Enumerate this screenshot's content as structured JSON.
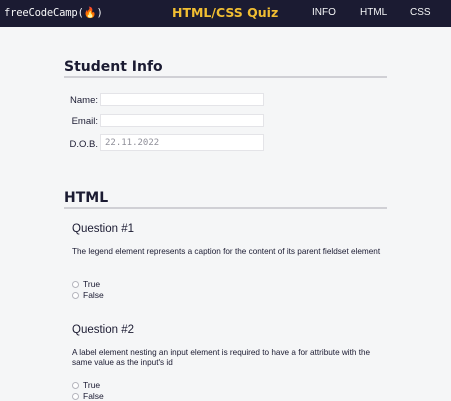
{
  "header": {
    "logo": "freeCodeCamp(🔥)",
    "title": "HTML/CSS Quiz",
    "nav": [
      "INFO",
      "HTML",
      "CSS"
    ]
  },
  "student_info": {
    "title": "Student Info",
    "name_label": "Name:",
    "email_label": "Email:",
    "dob_label": "D.O.B.",
    "dob_value": "22.11.2022"
  },
  "html_section": {
    "title": "HTML",
    "questions": [
      {
        "title": "Question #1",
        "text": "The legend element represents a caption for the content of its parent fieldset element",
        "options": [
          "True",
          "False"
        ]
      },
      {
        "title": "Question #2",
        "text": "A label element nesting an input element is required to have a for attribute with the same value as the input's id",
        "options": [
          "True",
          "False"
        ]
      }
    ]
  },
  "colors": {
    "header_bg": "#1b1b32",
    "title_accent": "#f1be32",
    "page_bg": "#f5f6f7"
  }
}
